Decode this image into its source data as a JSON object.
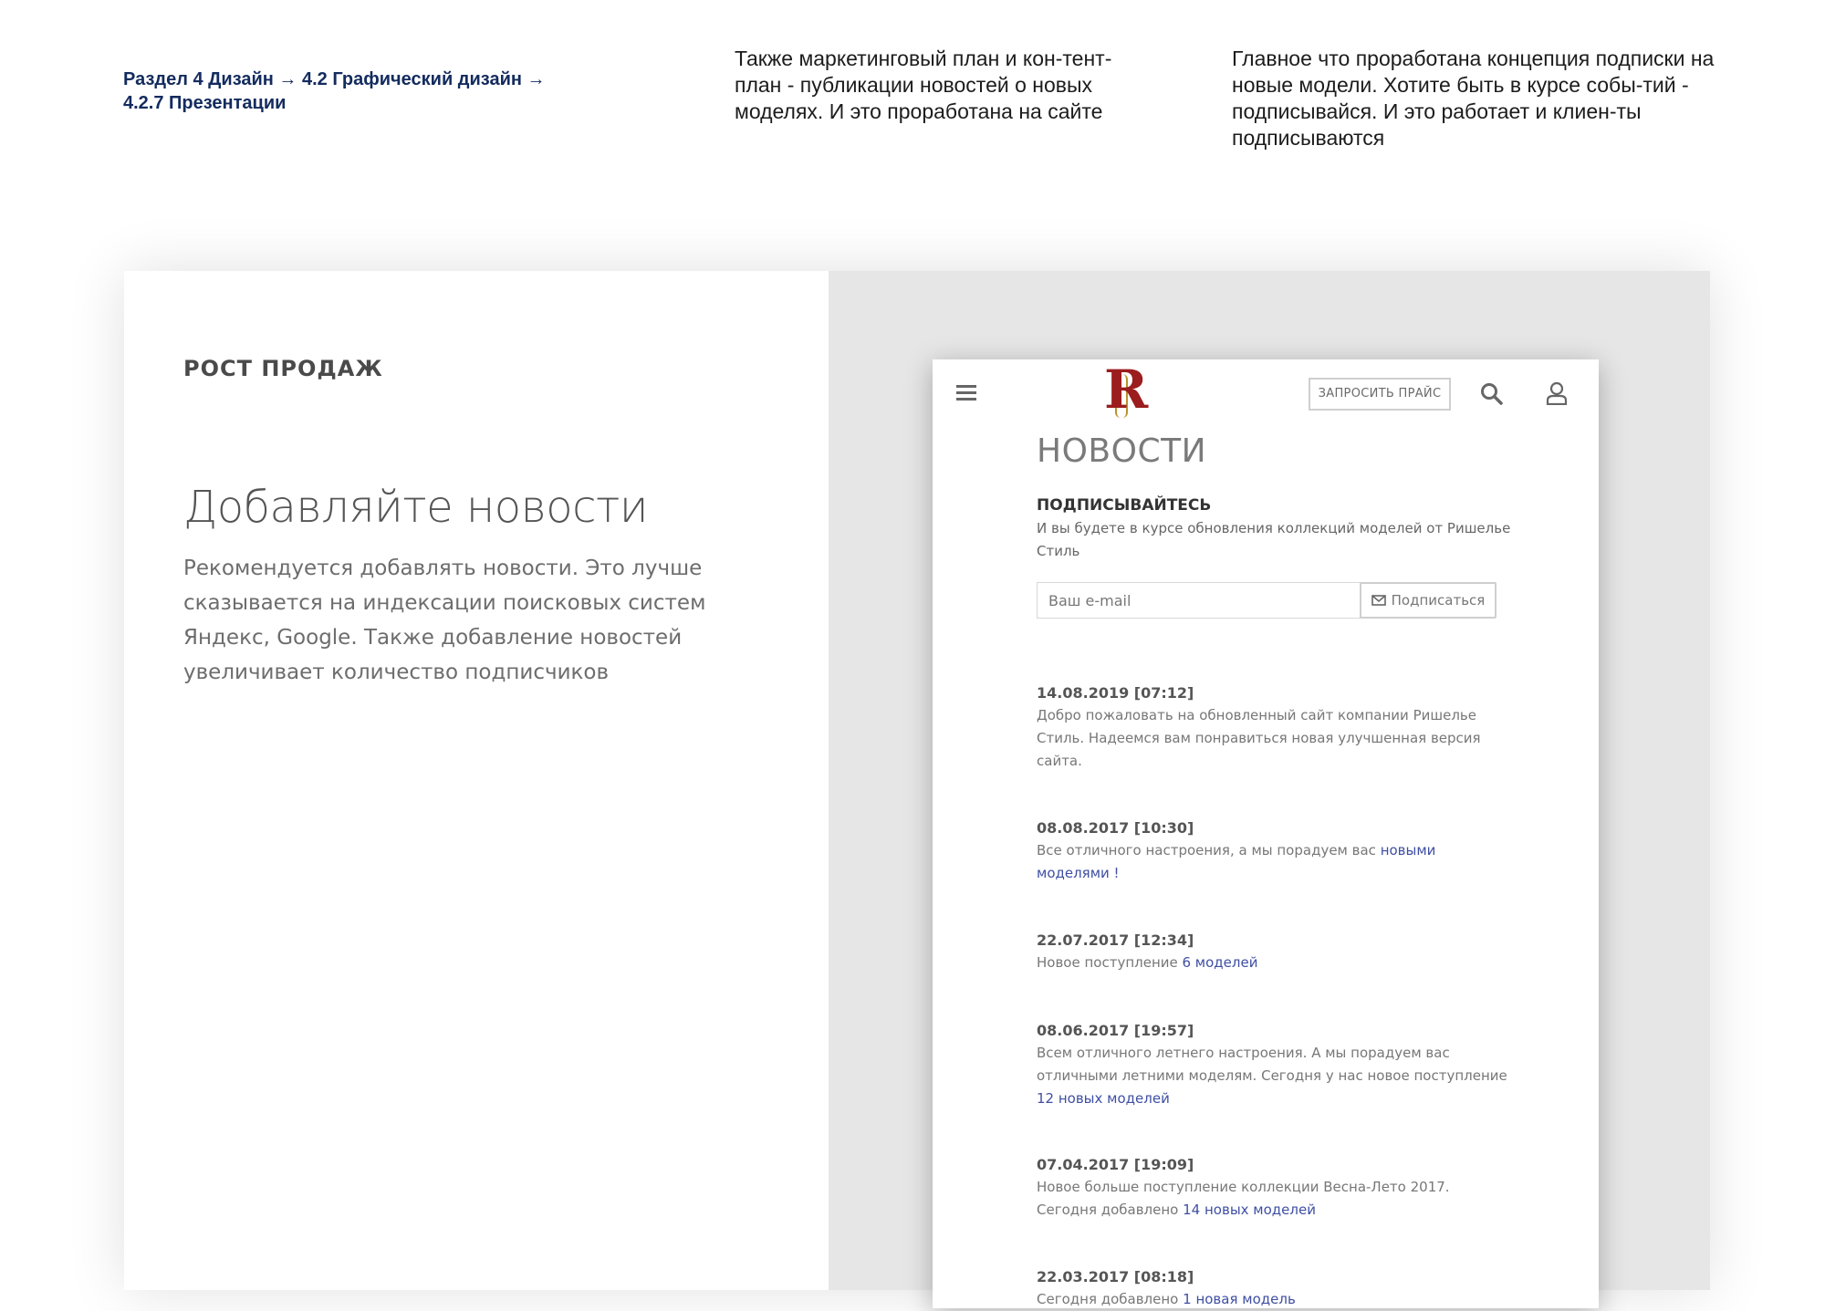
{
  "header": {
    "breadcrumb": {
      "line1": "Раздел 4 Дизайн  → 4.2 Графический дизайн →",
      "line2": "4.2.7 Презентации"
    },
    "note_marketing": "Также маркетинговый план и кон-тент-план - публикации новостей о новых моделях. И это проработана на сайте",
    "note_subscription": "Главное что проработана концепция подписки на новые модели. Хотите быть в курсе собы-тий - подписывайся. И это работает и клиен-ты подписываются"
  },
  "panel": {
    "section_label": "РОСТ ПРОДАЖ",
    "headline": "Добавляйте новости",
    "description": "Рекомендуется добавлять новости. Это лучше сказывается на индексации поисковых систем Яндекс, Google. Также добавление новостей увеличивает количество подписчиков"
  },
  "site": {
    "logo_letter": "R",
    "price_button": "ЗАПРОСИТЬ ПРАЙС",
    "icons": [
      "menu-icon",
      "search-icon",
      "user-icon",
      "envelope-icon"
    ],
    "news_title": "НОВОСТИ",
    "subscribe_title": "ПОДПИСЫВАЙТЕСЬ",
    "subscribe_text": "И вы будете в курсе обновления коллекций моделей от Ришелье Стиль",
    "email_placeholder": "Ваш e-mail",
    "subscribe_button": "Подписаться",
    "link_color": "#3f4fa3",
    "logo_color": "#9b1d1d",
    "news": [
      {
        "date": "14.08.2019 [07:12]",
        "text": "Добро пожаловать на обновленный сайт компании Ришелье Стиль. Надеемся вам понравиться новая улучшенная версия сайта.",
        "link": ""
      },
      {
        "date": "08.08.2017 [10:30]",
        "text": "Все отличного настроения, а мы порадуем вас ",
        "link": "новыми моделями !"
      },
      {
        "date": "22.07.2017 [12:34]",
        "text": "Новое поступление ",
        "link": "6 моделей"
      },
      {
        "date": "08.06.2017 [19:57]",
        "text": "Всем отличного летнего настроения. А мы порадуем вас отличными летними моделям. Сегодня у нас новое поступление ",
        "link": "12 новых моделей"
      },
      {
        "date": "07.04.2017 [19:09]",
        "text": "Новое больше поступление коллекции Весна-Лето 2017. Сегодня добавлено ",
        "link": "14 новых моделей"
      },
      {
        "date": "22.03.2017 [08:18]",
        "text": "Сегодня добавлено ",
        "link": "1 новая модель"
      }
    ]
  }
}
